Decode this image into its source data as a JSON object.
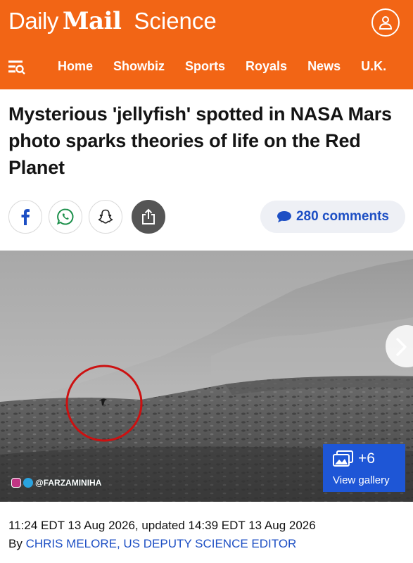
{
  "header": {
    "brand_daily": "Daily",
    "brand_mail": "Mail",
    "brand_section": "Science",
    "background": "#f26515",
    "nav": [
      "Home",
      "Showbiz",
      "Sports",
      "Royals",
      "News",
      "U.K."
    ]
  },
  "article": {
    "headline": "Mysterious 'jellyfish' spotted in NASA Mars photo sparks theories of life on the Red Planet",
    "comments_label": "280 comments",
    "timestamp": "11:24 EDT 13 Aug 2026, updated 14:39 EDT 13 Aug 2026",
    "byline_prefix": "By ",
    "author": "CHRIS MELORE, US DEPUTY SCIENCE EDITOR"
  },
  "share": {
    "icons": [
      "facebook-icon",
      "whatsapp-icon",
      "snapchat-icon",
      "share-icon"
    ]
  },
  "image": {
    "watermark": "@FARZAMINIHA",
    "gallery_count": "+6",
    "gallery_label": "View gallery",
    "highlight_color": "#cc1111"
  },
  "colors": {
    "accent": "#f26515",
    "link": "#1d4fc4",
    "gallery": "#1e56d6"
  }
}
